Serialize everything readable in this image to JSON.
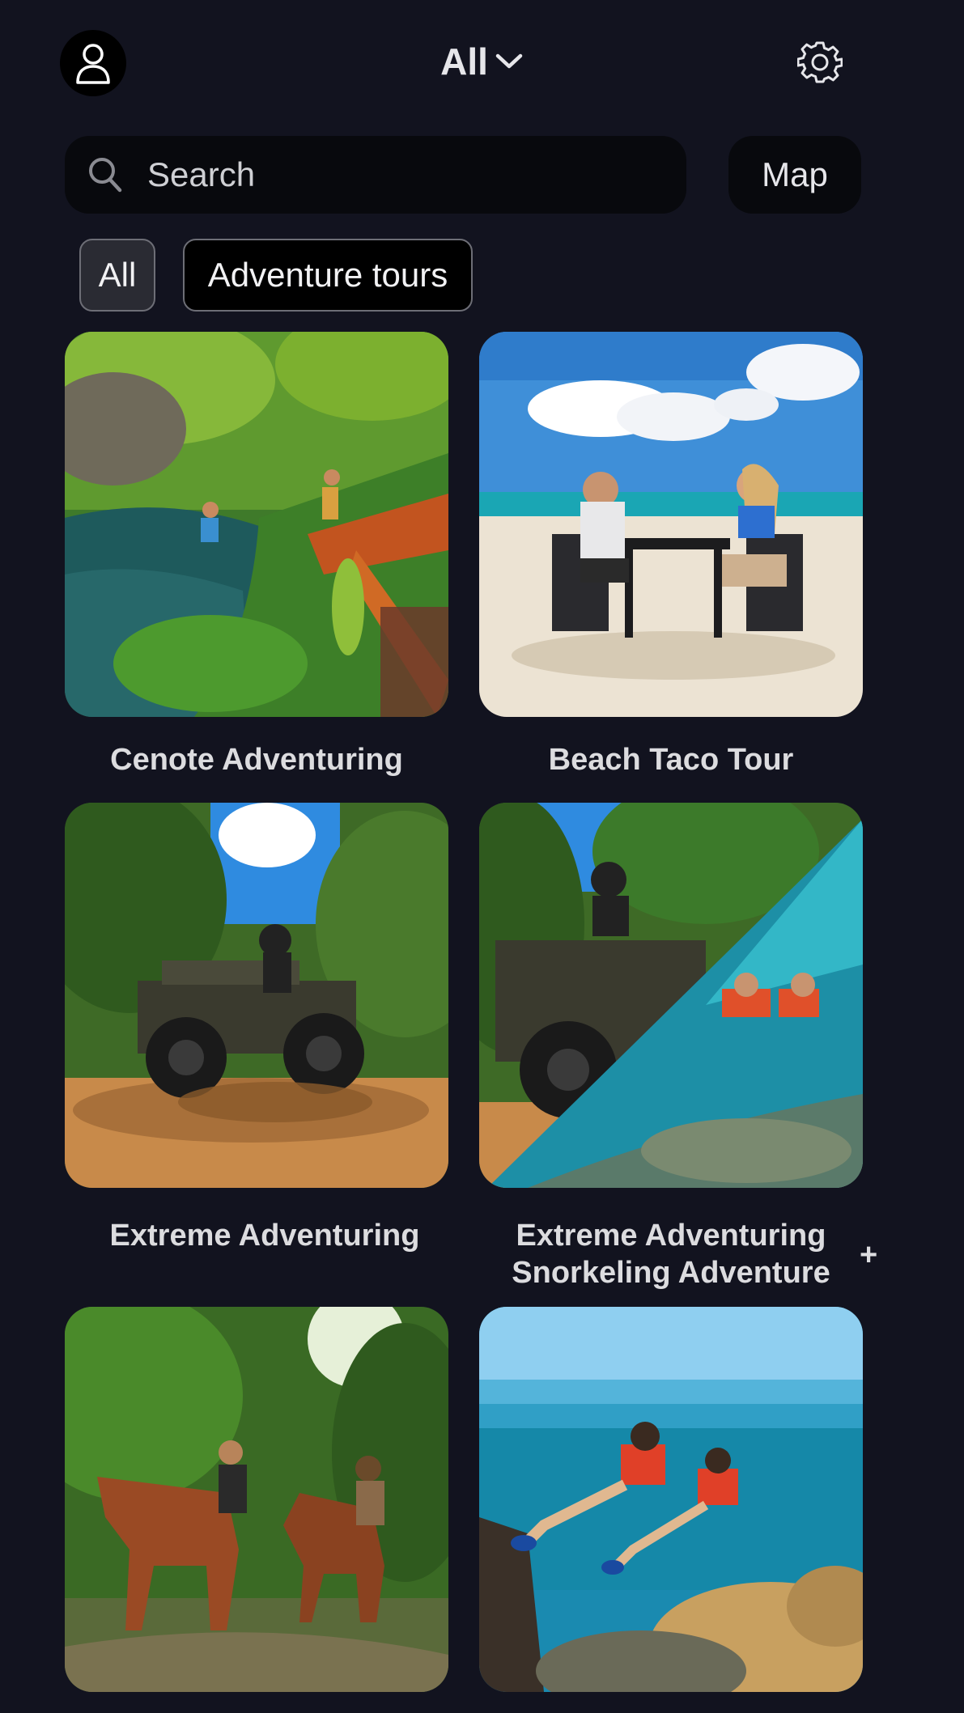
{
  "header": {
    "feed_label": "All",
    "profile_icon": "user-icon",
    "settings_icon": "gear-icon"
  },
  "search": {
    "placeholder": "Search",
    "value": "",
    "icon": "search-icon"
  },
  "map_button": {
    "label": "Map"
  },
  "filters": [
    {
      "label": "All",
      "selected": false
    },
    {
      "label": "Adventure tours",
      "selected": true
    }
  ],
  "cards": [
    {
      "title": "Cenote Adventuring",
      "image": "cenote-jump-photo"
    },
    {
      "title": "Beach Taco Tour",
      "image": "beach-dining-photo"
    },
    {
      "title": "Extreme Adventuring",
      "image": "atv-mud-photo"
    },
    {
      "title_line1": "Extreme Adventuring",
      "title_line2": "Snorkeling Adventure",
      "plus": "+",
      "image": "atv-snorkel-split-photo"
    },
    {
      "title": "",
      "image": "horseback-jungle-photo"
    },
    {
      "title": "",
      "image": "snorkel-reef-photo"
    }
  ],
  "colors": {
    "background": "#12131f",
    "surface": "#08090d",
    "chip_border": "#6d6e76",
    "text": "#e6e6ea"
  }
}
